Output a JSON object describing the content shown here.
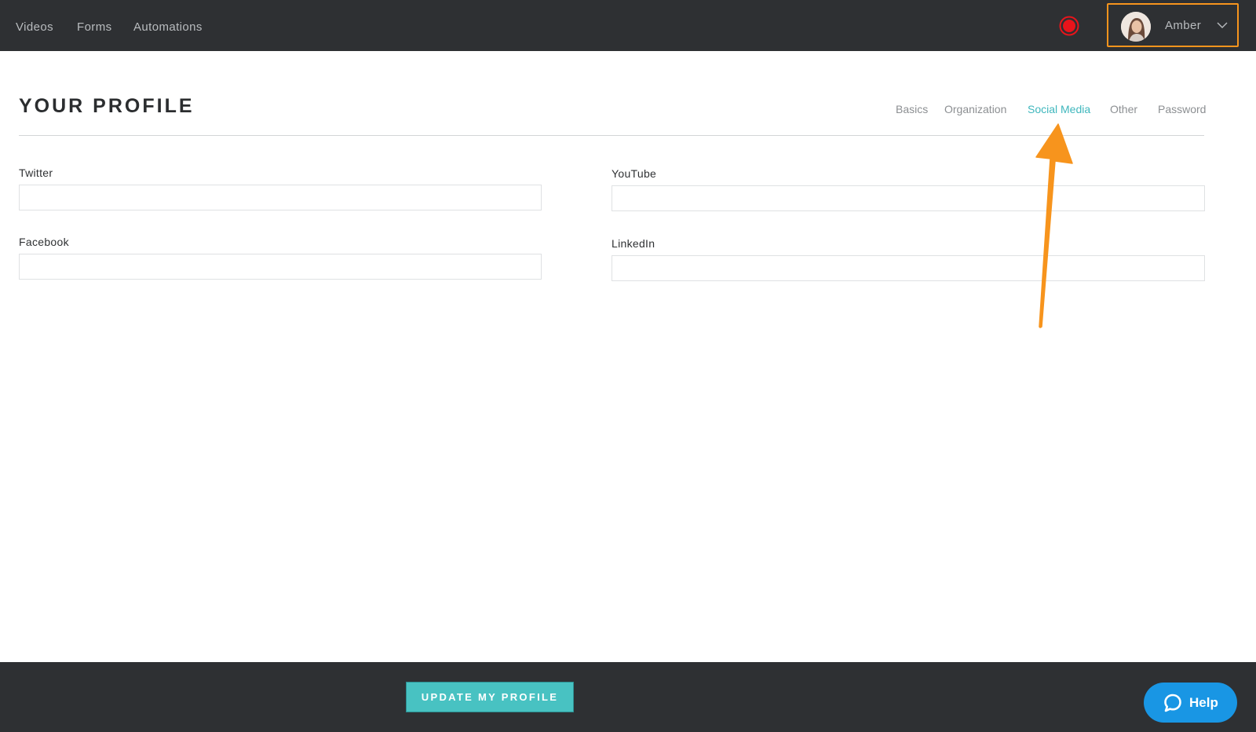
{
  "nav": {
    "links": [
      "Videos",
      "Forms",
      "Automations"
    ]
  },
  "user": {
    "name": "Amber"
  },
  "profile": {
    "title": "YOUR PROFILE",
    "tabs": [
      "Basics",
      "Organization",
      "Social Media",
      "Other",
      "Password"
    ],
    "active_tab": "Social Media"
  },
  "form": {
    "twitter_label": "Twitter",
    "twitter_value": "",
    "facebook_label": "Facebook",
    "facebook_value": "",
    "youtube_label": "YouTube",
    "youtube_value": "",
    "linkedin_label": "LinkedIn",
    "linkedin_value": ""
  },
  "footer": {
    "update_label": "UPDATE MY PROFILE",
    "help_label": "Help"
  },
  "colors": {
    "nav_bg": "#2e3033",
    "accent": "#3fb7bd",
    "button": "#48c2c2",
    "highlight": "#f7941d",
    "help": "#1996e4",
    "record": "#e8141b"
  },
  "icons": [
    "record-icon",
    "avatar",
    "chevron-down-icon",
    "help-chat-icon"
  ]
}
